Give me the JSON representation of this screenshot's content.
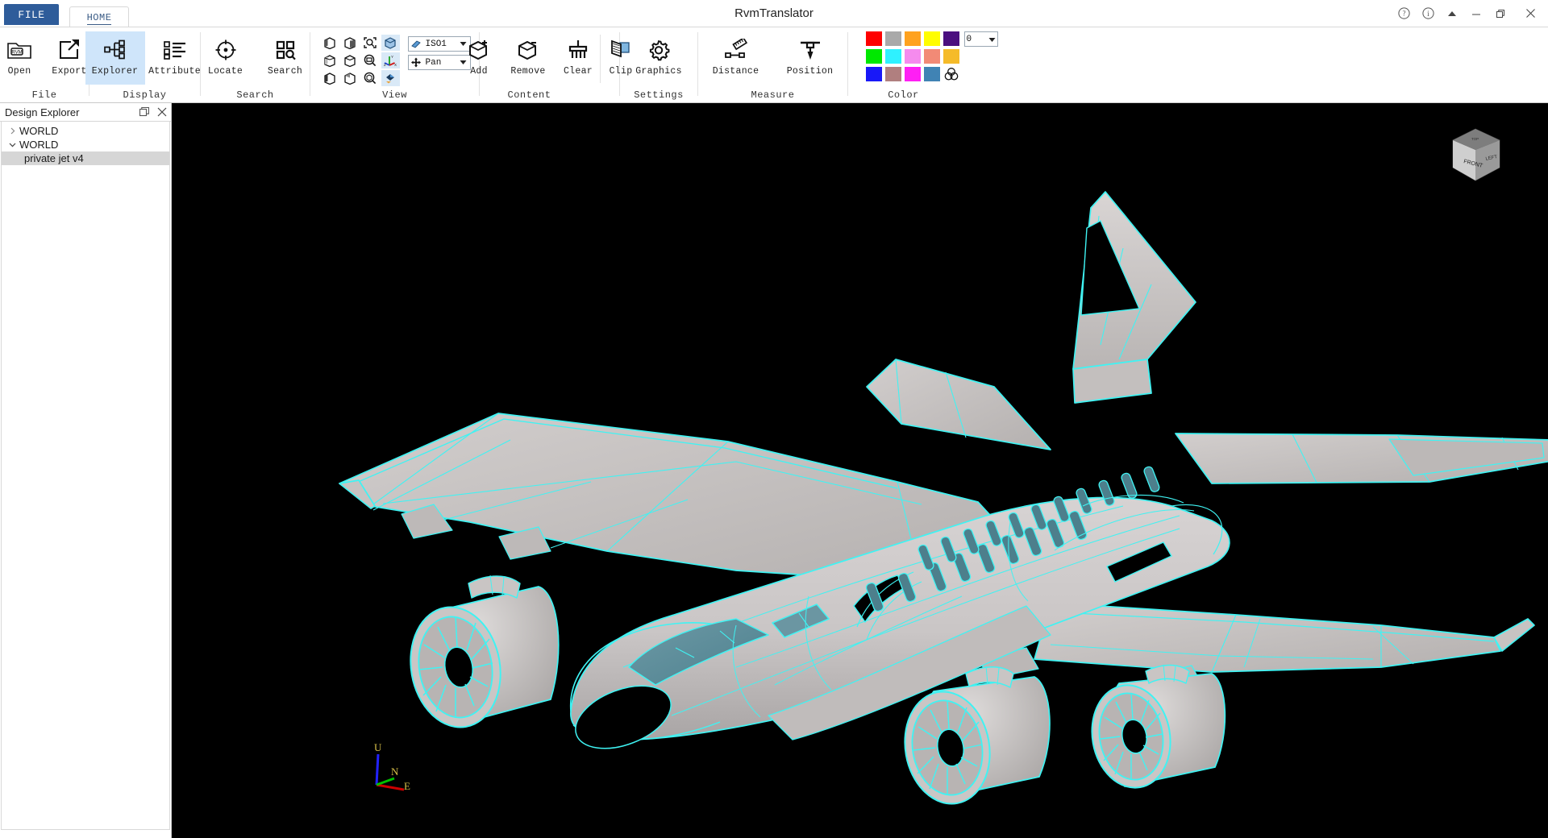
{
  "window": {
    "title": "RvmTranslator",
    "controls": [
      {
        "name": "help-button",
        "glyph": "?"
      },
      {
        "name": "info-button",
        "glyph": "i"
      },
      {
        "name": "collapse-ribbon-button",
        "glyph": "triangle"
      },
      {
        "name": "minimize-button",
        "glyph": "minimize"
      },
      {
        "name": "restore-button",
        "glyph": "restore"
      },
      {
        "name": "close-button",
        "glyph": "close"
      }
    ]
  },
  "tabs": [
    {
      "label": "FILE",
      "active": false
    },
    {
      "label": "HOME",
      "active": true
    }
  ],
  "ribbon": {
    "groups": [
      {
        "name": "File",
        "label": "File",
        "buttons": [
          {
            "label": "Open",
            "icon": "open-folder-rvm-icon"
          },
          {
            "label": "Export",
            "icon": "export-arrow-icon"
          }
        ]
      },
      {
        "name": "Display",
        "label": "Display",
        "buttons": [
          {
            "label": "Explorer",
            "icon": "tree-hierarchy-icon",
            "active": true
          },
          {
            "label": "Attribute",
            "icon": "list-attribute-icon"
          }
        ]
      },
      {
        "name": "Search",
        "label": "Search",
        "buttons": [
          {
            "label": "Locate",
            "icon": "target-crosshair-icon"
          },
          {
            "label": "Search",
            "icon": "grid-magnifier-icon"
          }
        ]
      },
      {
        "name": "View",
        "label": "View",
        "icons": [
          "box-shaded-left-icon",
          "box-shaded-top-icon",
          "zoom-fit-box-icon",
          "iso-cube-icon",
          "box-wire-left-icon",
          "box-wire-top-icon",
          "zoom-window-icon",
          "axis-triad-icon",
          "box-solid-left-icon",
          "box-solid-top-icon",
          "zoom-object-icon",
          "render-style-icon"
        ],
        "dropdowns": [
          {
            "name": "view-preset-dropdown",
            "value": "ISO1",
            "icon": "view-preset-icon"
          },
          {
            "name": "navigation-mode-dropdown",
            "value": "Pan",
            "icon": "pan-move-icon"
          }
        ]
      },
      {
        "name": "Content",
        "label": "Content",
        "buttons": [
          {
            "label": "Add",
            "icon": "box-plus-icon"
          },
          {
            "label": "Remove",
            "icon": "box-minus-icon"
          },
          {
            "label": "Clear",
            "icon": "broom-clear-icon"
          },
          {
            "label": "Clip",
            "icon": "clip-plane-icon"
          }
        ]
      },
      {
        "name": "Settings",
        "label": "Settings",
        "buttons": [
          {
            "label": "Graphics",
            "icon": "gear-icon"
          }
        ]
      },
      {
        "name": "Measure",
        "label": "Measure",
        "buttons": [
          {
            "label": "Distance",
            "icon": "ruler-distance-icon"
          },
          {
            "label": "Position",
            "icon": "position-pin-icon"
          }
        ]
      },
      {
        "name": "Color",
        "label": "Color",
        "swatches": [
          "#fe0000",
          "#a9a9a9",
          "#ffa21f",
          "#fffd00",
          "#4b0f7f",
          "#00e800",
          "#2ff1ff",
          "#f58bee",
          "#f28a76",
          "#f5bb29",
          "#1818f8",
          "#b07f7f",
          "#ff1ff4",
          "#4083b4",
          ""
        ],
        "overlap_icon": "color-blend-icon",
        "number_dropdown": {
          "name": "transparency-dropdown",
          "value": "0"
        }
      }
    ]
  },
  "explorer": {
    "title": "Design Explorer",
    "float_icon": "float-panel-icon",
    "close_icon": "close-icon",
    "tree": [
      {
        "label": "WORLD",
        "expanded": false,
        "depth": 0,
        "selected": false
      },
      {
        "label": "WORLD",
        "expanded": true,
        "depth": 0,
        "selected": false
      },
      {
        "label": "private jet v4",
        "expanded": null,
        "depth": 1,
        "selected": true
      }
    ]
  },
  "viewport": {
    "background": "#000000",
    "surface_color": "#c8c4c4",
    "edge_color": "#3ff3f3",
    "glass_color": "#5c8d99",
    "view_cube": {
      "face_label": "FRONT",
      "side_label": "LEFT"
    },
    "axis_triad": {
      "up": {
        "label": "U",
        "color": "#2222ff"
      },
      "north": {
        "label": "N",
        "color": "#00c000"
      },
      "east": {
        "label": "E",
        "color": "#cc0000"
      },
      "label_color": "#d8c048"
    }
  }
}
